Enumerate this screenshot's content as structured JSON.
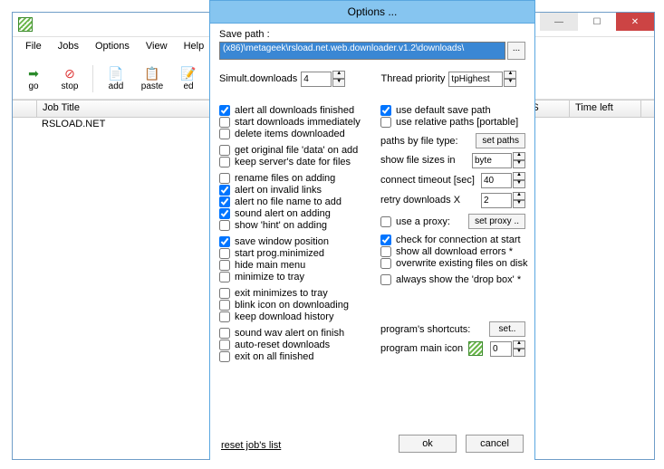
{
  "main": {
    "menu": [
      "File",
      "Jobs",
      "Options",
      "View",
      "Help"
    ],
    "tools": {
      "go": "go",
      "stop": "stop",
      "add": "add",
      "paste": "paste",
      "edit": "ed"
    },
    "gridHeaders": {
      "job": "Job Title",
      "ps": "PS",
      "time": "Time left"
    },
    "rows": [
      {
        "title": "RSLOAD.NET"
      }
    ],
    "winbtns": {
      "min": "—",
      "max": "☐",
      "close": "✕"
    }
  },
  "dlg": {
    "title": "Options ...",
    "savepath_lbl": "Save path :",
    "savepath_val": "(x86)\\metageek\\rsload.net.web.downloader.v1.2\\downloads\\",
    "browse": "...",
    "simult_lbl": "Simult.downloads",
    "simult_val": "4",
    "thread_lbl": "Thread priority",
    "thread_val": "tpHighest",
    "left": {
      "g1": [
        {
          "c": true,
          "t": "alert all downloads finished"
        },
        {
          "c": false,
          "t": "start downloads immediately"
        },
        {
          "c": false,
          "t": "delete items downloaded"
        }
      ],
      "g2": [
        {
          "c": false,
          "t": "get original file 'data' on add"
        },
        {
          "c": false,
          "t": "keep server's date for files"
        }
      ],
      "g3": [
        {
          "c": false,
          "t": "rename files on adding"
        },
        {
          "c": true,
          "t": "alert on invalid links"
        },
        {
          "c": true,
          "t": "alert no file name to add"
        },
        {
          "c": true,
          "t": "sound alert on adding"
        },
        {
          "c": false,
          "t": "show 'hint' on adding"
        }
      ],
      "g4": [
        {
          "c": true,
          "t": "save window position"
        },
        {
          "c": false,
          "t": "start prog.minimized"
        },
        {
          "c": false,
          "t": "hide main menu"
        },
        {
          "c": false,
          "t": "minimize to tray"
        }
      ],
      "g5": [
        {
          "c": false,
          "t": "exit minimizes to tray"
        },
        {
          "c": false,
          "t": "blink icon on downloading"
        },
        {
          "c": false,
          "t": "keep download history"
        }
      ],
      "g6": [
        {
          "c": false,
          "t": "sound wav alert on finish"
        },
        {
          "c": false,
          "t": "auto-reset downloads"
        },
        {
          "c": false,
          "t": "exit on all finished"
        }
      ]
    },
    "right": {
      "g1": [
        {
          "c": true,
          "t": "use default save path"
        },
        {
          "c": false,
          "t": "use relative paths [portable]"
        }
      ],
      "paths_lbl": "paths by file type:",
      "paths_btn": "set paths",
      "sizes_lbl": "show file sizes in",
      "sizes_val": "byte",
      "timeout_lbl": "connect timeout [sec]",
      "timeout_val": "40",
      "retry_lbl": "retry downloads  X",
      "retry_val": "2",
      "proxy_cb": "use a proxy:",
      "proxy_btn": "set proxy ..",
      "g2": [
        {
          "c": true,
          "t": "check for connection at start"
        },
        {
          "c": false,
          "t": "show all download errors *"
        },
        {
          "c": false,
          "t": "overwrite existing files on disk"
        }
      ],
      "dropbox": {
        "c": false,
        "t": "always show the 'drop box' *"
      },
      "shortcuts_lbl": "program's shortcuts:",
      "shortcuts_btn": "set..",
      "icon_lbl": "program main icon",
      "icon_val": "0"
    },
    "reset": "reset job's list",
    "ok": "ok",
    "cancel": "cancel"
  }
}
